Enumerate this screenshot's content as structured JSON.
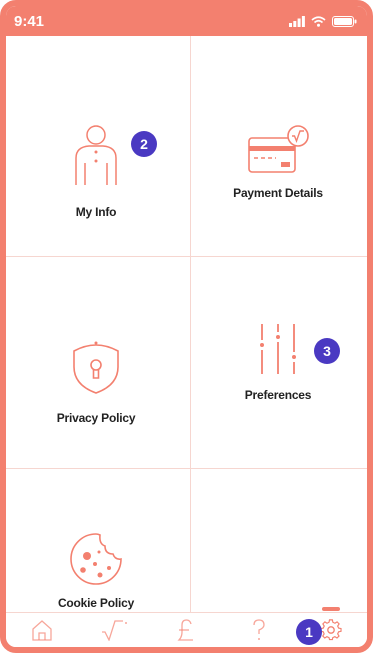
{
  "status": {
    "time": "9:41"
  },
  "tiles": [
    {
      "label": "My Info",
      "icon": "person-icon"
    },
    {
      "label": "Payment Details",
      "icon": "credit-card-icon"
    },
    {
      "label": "Privacy Policy",
      "icon": "shield-lock-icon"
    },
    {
      "label": "Preferences",
      "icon": "sliders-icon"
    },
    {
      "label": "Cookie Policy",
      "icon": "cookie-icon"
    }
  ],
  "badges": {
    "one": "1",
    "two": "2",
    "three": "3"
  },
  "tabs": [
    {
      "icon": "home-icon"
    },
    {
      "icon": "sqrt-icon"
    },
    {
      "icon": "pound-icon"
    },
    {
      "icon": "help-icon"
    },
    {
      "icon": "settings-icon",
      "active": true
    }
  ],
  "colors": {
    "accent": "#f3806f",
    "badge": "#4a39c2"
  }
}
